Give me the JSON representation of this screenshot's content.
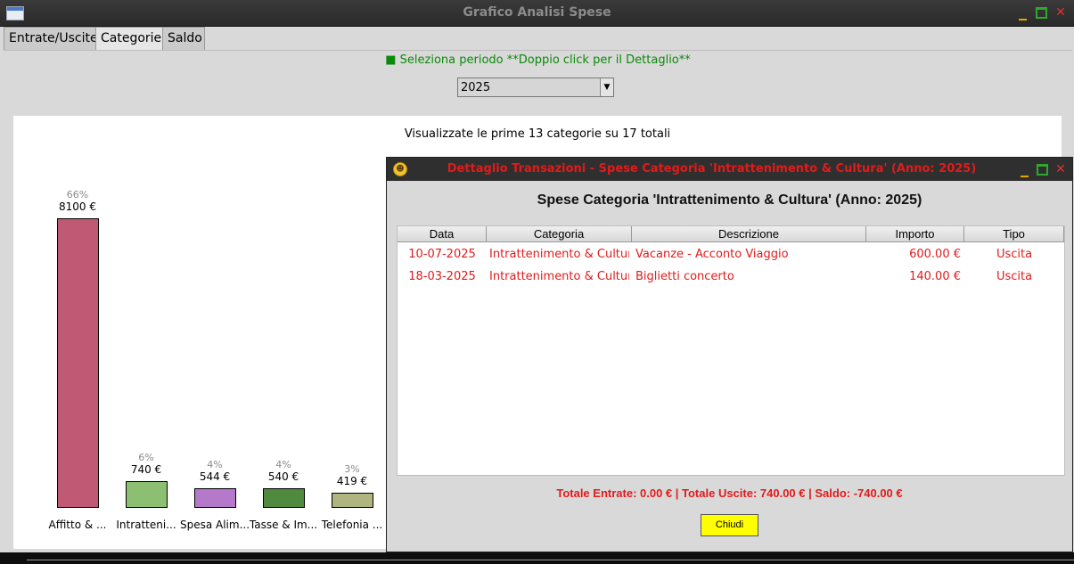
{
  "window": {
    "title": "Grafico Analisi Spese",
    "tabs": [
      {
        "label": "Entrate/Uscite"
      },
      {
        "label": "Categorie"
      },
      {
        "label": "Saldo"
      }
    ],
    "active_tab": "Categorie"
  },
  "controls": {
    "hint": "■ Seleziona periodo **Doppio click per il Dettaglio**",
    "period_value": "2025"
  },
  "chart_data": {
    "type": "bar",
    "title": "Visualizzate le prime 13 categorie su 17 totali",
    "categories": [
      "Affitto & ...",
      "Intratteni...",
      "Spesa Alim...",
      "Tasse & Im...",
      "Telefonia ..."
    ],
    "values": [
      8100,
      740,
      544,
      540,
      419
    ],
    "value_labels": [
      "8100 €",
      "740 €",
      "544 €",
      "540 €",
      "419 €"
    ],
    "percent_labels": [
      "66%",
      "6%",
      "4%",
      "4%",
      "3%"
    ],
    "colors": [
      "#c05a74",
      "#8cbf72",
      "#b479c8",
      "#4f8a3e",
      "#b0b47e"
    ],
    "xlabel": "",
    "ylabel": ""
  },
  "dialog": {
    "title": "Dettaglio Transazioni - Spese Categoria 'Intrattenimento & Cultura' (Anno: 2025)",
    "heading": "Spese Categoria 'Intrattenimento & Cultura' (Anno: 2025)",
    "columns": [
      "Data",
      "Categoria",
      "Descrizione",
      "Importo",
      "Tipo"
    ],
    "rows": [
      [
        "10-07-2025",
        "Intrattenimento & Cultura",
        "Vacanze - Acconto Viaggio",
        "600.00 €",
        "Uscita"
      ],
      [
        "18-03-2025",
        "Intrattenimento & Cultura",
        "Biglietti concerto",
        "140.00 €",
        "Uscita"
      ]
    ],
    "summary": "Totale Entrate: 0.00 € | Totale Uscite: 740.00 € | Saldo: -740.00 €",
    "close_label": "Chiudi"
  }
}
